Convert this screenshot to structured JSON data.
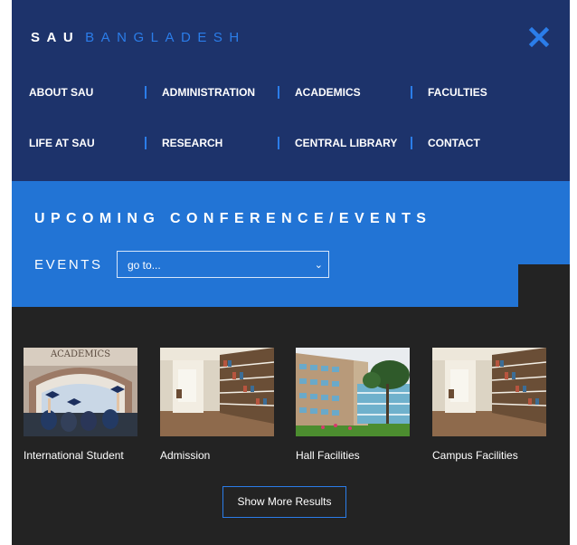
{
  "brand": {
    "part1": "SAU",
    "part2": "BANGLADESH"
  },
  "nav": {
    "row1": [
      "ABOUT SAU",
      "ADMINISTRATION",
      "ACADEMICS",
      "FACULTIES"
    ],
    "row2": [
      "LIFE AT SAU",
      "RESEARCH",
      "CENTRAL LIBRARY",
      "CONTACT"
    ]
  },
  "events": {
    "title": "UPCOMING CONFERENCE/EVENTS",
    "label": "EVENTS",
    "select_value": "go to..."
  },
  "cards": [
    {
      "caption": "International Student",
      "image_text": "ACADEMICS"
    },
    {
      "caption": "Admission"
    },
    {
      "caption": "Hall Facilities"
    },
    {
      "caption": "Campus Facilities"
    }
  ],
  "more_button": "Show More Results",
  "icons": {
    "close": "close-icon",
    "select": "chevron-down-icon"
  },
  "colors": {
    "nav_bg": "#1d336b",
    "accent": "#2b7de9",
    "band_bg": "#2274d5",
    "page_bg": "#232323"
  }
}
